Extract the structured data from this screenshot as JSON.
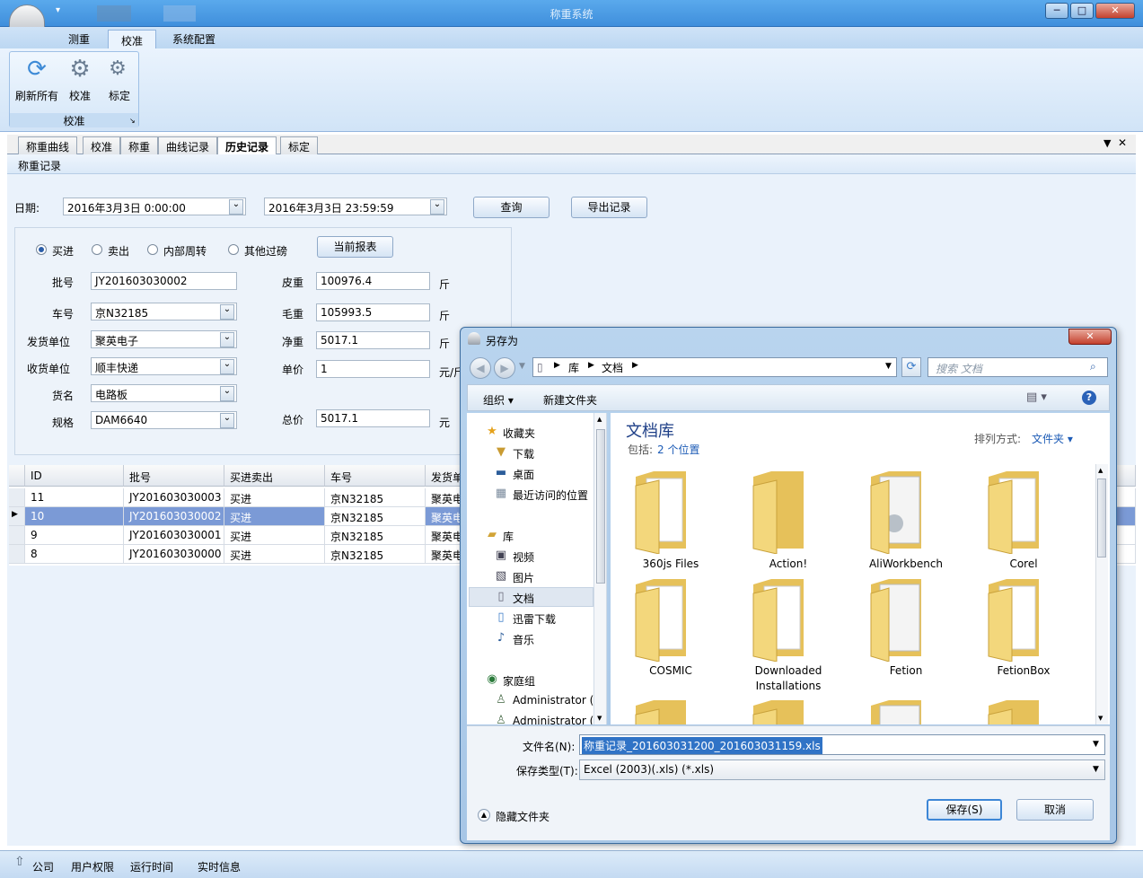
{
  "window": {
    "title": "称重系统",
    "minimize": "─",
    "maximize": "□",
    "close": "✕"
  },
  "ribbon": {
    "tabs": [
      "测重",
      "校准",
      "系统配置"
    ],
    "buttons": [
      {
        "label": "刷新所有",
        "icon": "refresh-icon"
      },
      {
        "label": "校准",
        "icon": "gear-icon"
      },
      {
        "label": "标定",
        "icon": "gears-icon"
      }
    ],
    "group_label": "校准"
  },
  "doc_tabs": [
    "称重曲线",
    "校准",
    "称重",
    "曲线记录",
    "历史记录",
    "标定"
  ],
  "panel_title": "称重记录",
  "filter": {
    "date_label": "日期:",
    "start": "2016年3月3日 0:00:00",
    "end": "2016年3月3日 23:59:59",
    "query_button": "查询",
    "export_button": "导出记录"
  },
  "form": {
    "radios": [
      {
        "label": "买进",
        "checked": true
      },
      {
        "label": "卖出",
        "checked": false
      },
      {
        "label": "内部周转",
        "checked": false
      },
      {
        "label": "其他过磅",
        "checked": false
      }
    ],
    "report_button": "当前报表",
    "batch_label": "批号",
    "batch": "JY201603030002",
    "plate_label": "车号",
    "plate": "京N32185",
    "sender_label": "发货单位",
    "sender": "聚英电子",
    "receiver_label": "收货单位",
    "receiver": "顺丰快递",
    "goods_label": "货名",
    "goods": "电路板",
    "spec_label": "规格",
    "spec": "DAM6640",
    "tare_label": "皮重",
    "tare": "100976.4",
    "tare_unit": "斤",
    "gross_label": "毛重",
    "gross": "105993.5",
    "gross_unit": "斤",
    "net_label": "净重",
    "net": "5017.1",
    "net_unit": "斤",
    "price_label": "单价",
    "price": "1",
    "price_unit": "元/斤",
    "total_label": "总价",
    "total": "5017.1",
    "total_unit": "元"
  },
  "grid": {
    "headers": [
      "ID",
      "批号",
      "买进卖出",
      "车号",
      "发货单"
    ],
    "rows": [
      [
        "11",
        "JY201603030003",
        "买进",
        "京N32185",
        "聚英电"
      ],
      [
        "10",
        "JY201603030002",
        "买进",
        "京N32185",
        "聚英电"
      ],
      [
        "9",
        "JY201603030001",
        "买进",
        "京N32185",
        "聚英电"
      ],
      [
        "8",
        "JY201603030000",
        "买进",
        "京N32185",
        "聚英电"
      ]
    ]
  },
  "status": [
    "公司",
    "用户权限",
    "运行时间",
    "实时信息"
  ],
  "dialog": {
    "title": "另存为",
    "breadcrumb": [
      "库",
      "文档"
    ],
    "search_placeholder": "搜索 文档",
    "organize": "组织 ▾",
    "new_folder": "新建文件夹",
    "nav": {
      "favorites": "收藏夹",
      "downloads": "下载",
      "desktop": "桌面",
      "recent": "最近访问的位置",
      "libraries": "库",
      "videos": "视频",
      "pictures": "图片",
      "documents": "文档",
      "xunlei": "迅雷下载",
      "music": "音乐",
      "homegroup": "家庭组",
      "admin1": "Administrator (",
      "admin2": "Administrator (L"
    },
    "library_title": "文档库",
    "includes_label": "包括:",
    "includes_link": "2 个位置",
    "arrange_label": "排列方式:",
    "arrange_value": "文件夹 ▾",
    "folders": [
      "360js Files",
      "Action!",
      "AliWorkbench",
      "Corel",
      "COSMIC",
      "Downloaded Installations",
      "Fetion",
      "FetionBox"
    ],
    "filename_label": "文件名(N):",
    "filename": "称重记录_201603031200_201603031159.xls",
    "filetype_label": "保存类型(T):",
    "filetype": "Excel (2003)(.xls) (*.xls)",
    "hide_folders": "隐藏文件夹",
    "save_button": "保存(S)",
    "cancel_button": "取消"
  }
}
